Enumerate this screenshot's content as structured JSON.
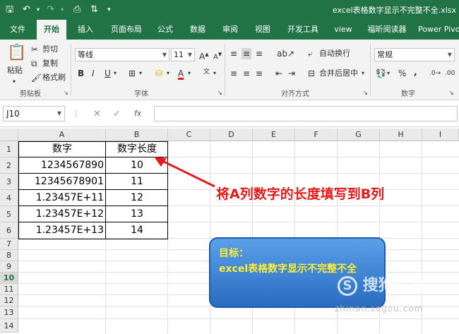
{
  "window": {
    "file_title": "excel表格数字显示不完整不全.xlsx"
  },
  "tabs": [
    "文件",
    "开始",
    "插入",
    "页面布局",
    "公式",
    "数据",
    "审阅",
    "视图",
    "开发工具",
    "view",
    "福昕阅读器",
    "Power Pivot"
  ],
  "ribbon": {
    "paste": "粘贴",
    "cut": "剪切",
    "copy": "复制",
    "format_painter": "格式刷",
    "clipboard_group": "剪贴板",
    "font_name": "等线",
    "font_size": "11",
    "font_group": "字体",
    "wrap_text": "自动换行",
    "merge_center": "合并后居中",
    "alignment_group": "对齐方式",
    "number_format": "常规",
    "number_group": "数字",
    "bold": "B",
    "italic": "I",
    "underline": "U",
    "percent": "%",
    "comma": ","
  },
  "formula_bar": {
    "name_box": "J10",
    "fx": "fx"
  },
  "columns": [
    "A",
    "B",
    "C",
    "D",
    "E",
    "F",
    "G",
    "H",
    "I"
  ],
  "rows": [
    "1",
    "2",
    "3",
    "4",
    "5",
    "6",
    "7",
    "8",
    "9",
    "10",
    "11",
    "12",
    "13",
    "14"
  ],
  "table": {
    "headers": [
      "数字",
      "数字长度"
    ],
    "rows": [
      [
        "1234567890",
        "10"
      ],
      [
        "12345678901",
        "11"
      ],
      [
        "1.23457E+11",
        "12"
      ],
      [
        "1.23457E+12",
        "13"
      ],
      [
        "1.23457E+13",
        "14"
      ]
    ]
  },
  "annotation": "将A列数字的长度填写到B列",
  "goal": {
    "title": "目标：",
    "text": "excel表格数字显示不完整不全"
  },
  "watermark": {
    "brand": "搜狗指南",
    "url": "zhinan.sogou.com"
  },
  "colors": {
    "excel_green": "#217346",
    "annotation_red": "#e51b1b",
    "goal_yellow": "#ffee33"
  }
}
